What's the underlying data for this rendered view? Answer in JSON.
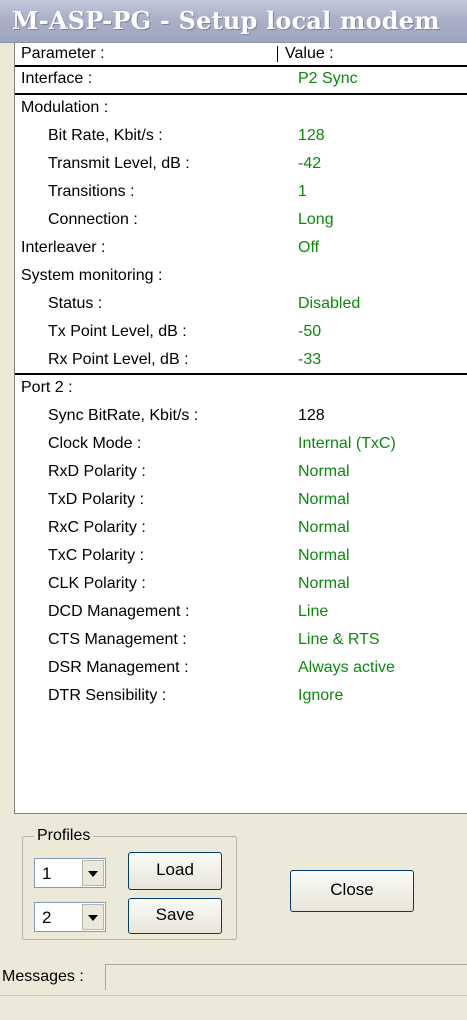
{
  "window": {
    "title": "M-ASP-PG - Setup local modem"
  },
  "grid": {
    "header": {
      "parameter": "Parameter :",
      "value": "Value :"
    },
    "rows": [
      {
        "param": "Interface :",
        "value": "P2 Sync"
      },
      {
        "param": "Modulation :",
        "value": ""
      },
      {
        "param": "Bit Rate, Kbit/s :",
        "value": "128"
      },
      {
        "param": "Transmit Level, dB :",
        "value": "-42"
      },
      {
        "param": "Transitions :",
        "value": "1"
      },
      {
        "param": "Connection :",
        "value": "Long"
      },
      {
        "param": "Interleaver :",
        "value": "Off"
      },
      {
        "param": "System monitoring :",
        "value": ""
      },
      {
        "param": "Status :",
        "value": "Disabled"
      },
      {
        "param": "Tx Point Level, dB :",
        "value": "-50"
      },
      {
        "param": "Rx Point Level, dB :",
        "value": "-33"
      },
      {
        "param": "Port 2 :",
        "value": ""
      },
      {
        "param": "Sync BitRate, Kbit/s :",
        "value": "128"
      },
      {
        "param": "Clock Mode :",
        "value": "Internal (TxC)"
      },
      {
        "param": "RxD Polarity :",
        "value": "Normal"
      },
      {
        "param": "TxD Polarity :",
        "value": "Normal"
      },
      {
        "param": "RxC Polarity :",
        "value": "Normal"
      },
      {
        "param": "TxC Polarity :",
        "value": "Normal"
      },
      {
        "param": "CLK Polarity :",
        "value": "Normal"
      },
      {
        "param": "DCD Management :",
        "value": "Line"
      },
      {
        "param": "CTS Management :",
        "value": "Line & RTS"
      },
      {
        "param": "DSR Management :",
        "value": "Always active"
      },
      {
        "param": "DTR Sensibility :",
        "value": "Ignore"
      }
    ],
    "value_color": "#0a8a0a"
  },
  "profiles": {
    "label": "Profiles",
    "load_select": "1",
    "save_select": "2",
    "load_label": "Load",
    "save_label": "Save"
  },
  "close_label": "Close",
  "messages": {
    "label": "Messages :",
    "value": ""
  }
}
